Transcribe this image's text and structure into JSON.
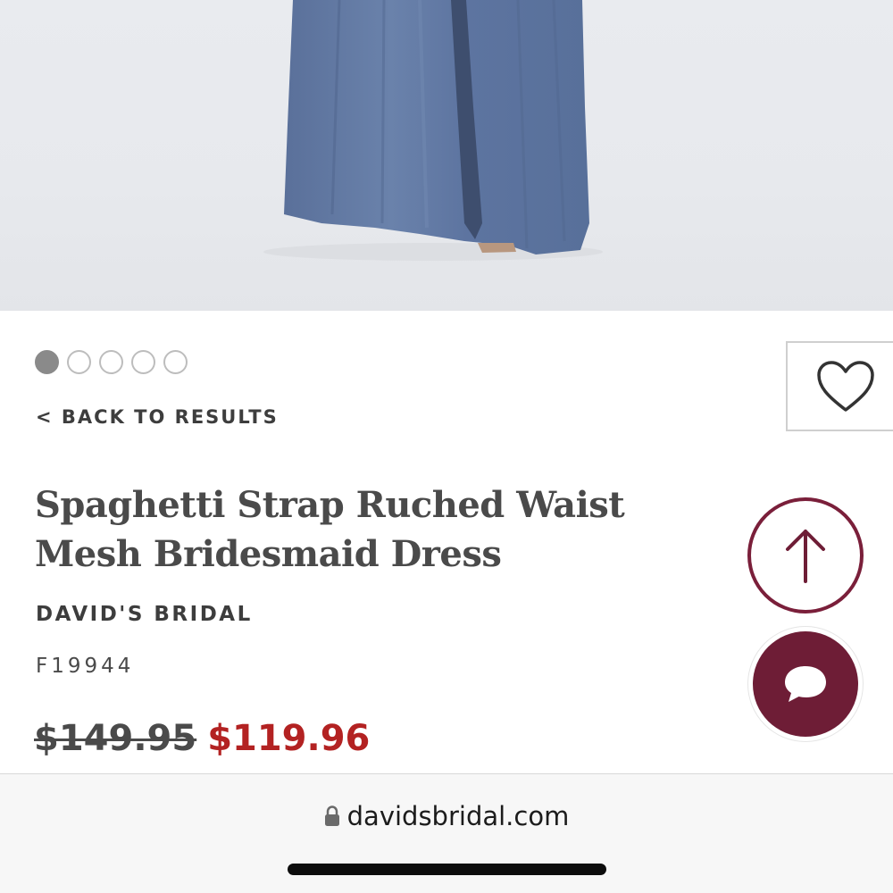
{
  "product": {
    "back_label": "< BACK TO RESULTS",
    "title_line1": "Spaghetti Strap Ruched Waist",
    "title_line2": "Mesh Bridesmaid Dress",
    "brand": "DAVID'S BRIDAL",
    "sku": "F19944",
    "price_original": "$149.95",
    "price_sale": "$119.96"
  },
  "carousel": {
    "total": 5,
    "active_index": 0
  },
  "icons": {
    "wishlist": "heart-icon",
    "scroll_top": "arrow-up-icon",
    "chat": "chat-bubble-icon",
    "lock": "lock-icon"
  },
  "colors": {
    "dress": "#5f77a0",
    "sale_price": "#b32222",
    "brand_accent": "#6e1d36"
  },
  "browser": {
    "url": "davidsbridal.com"
  }
}
